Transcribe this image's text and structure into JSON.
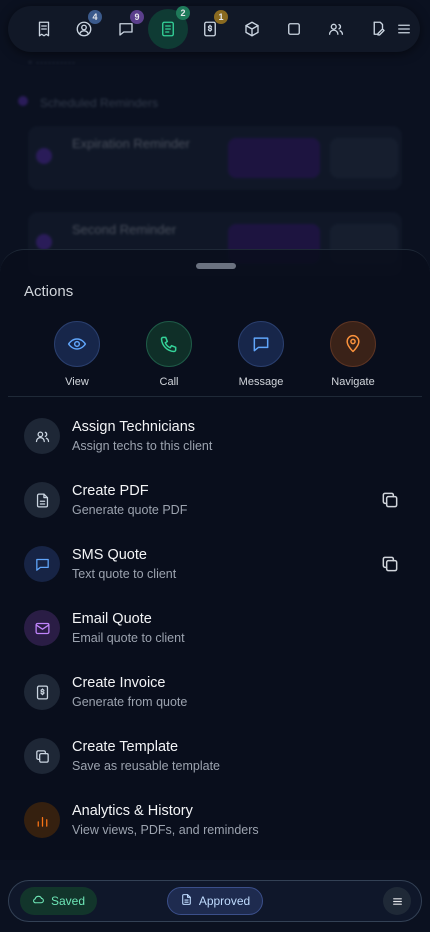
{
  "nav": {
    "items": [
      {
        "icon": "receipt-icon",
        "badge": null
      },
      {
        "icon": "user-circle-icon",
        "badge": "4",
        "badge_color": "#3b5a8c"
      },
      {
        "icon": "chat-icon",
        "badge": "9",
        "badge_color": "#5b3f8c"
      },
      {
        "icon": "document-icon",
        "badge": "2",
        "badge_color": "#1f7a5a",
        "active": true
      },
      {
        "icon": "invoice-icon",
        "badge": "1",
        "badge_color": "#8a6a20"
      },
      {
        "icon": "cube-icon",
        "badge": null
      },
      {
        "icon": "square-icon",
        "badge": null
      },
      {
        "icon": "users-icon",
        "badge": null
      },
      {
        "icon": "pen-icon",
        "badge": null
      },
      {
        "icon": "menu-icon",
        "badge": null
      }
    ]
  },
  "background": {
    "scheduled_reminders": "Scheduled Reminders",
    "expiration_reminder": "Expiration Reminder",
    "second_reminder": "Second Reminder"
  },
  "sheet": {
    "title": "Actions",
    "quick_actions": [
      {
        "label": "View",
        "icon": "eye-icon",
        "color": "#60a5fa",
        "bg": "#17264a",
        "border": "#2a3f6e"
      },
      {
        "label": "Call",
        "icon": "phone-icon",
        "color": "#34d399",
        "bg": "#0f2f28",
        "border": "#1e5a47"
      },
      {
        "label": "Message",
        "icon": "chat-bubble-icon",
        "color": "#60a5fa",
        "bg": "#17264a",
        "border": "#2a3f6e"
      },
      {
        "label": "Navigate",
        "icon": "map-pin-icon",
        "color": "#fb923c",
        "bg": "#3a2218",
        "border": "#5c3423"
      }
    ],
    "actions": [
      {
        "title": "Assign Technicians",
        "subtitle": "Assign techs to this client",
        "icon": "users-icon",
        "bg": "#1e2736",
        "color": "#cbd5e1",
        "copy": false
      },
      {
        "title": "Create PDF",
        "subtitle": "Generate quote PDF",
        "icon": "file-icon",
        "bg": "#1e2736",
        "color": "#cbd5e1",
        "copy": true
      },
      {
        "title": "SMS Quote",
        "subtitle": "Text quote to client",
        "icon": "sms-icon",
        "bg": "#172445",
        "color": "#60a5fa",
        "copy": true
      },
      {
        "title": "Email Quote",
        "subtitle": "Email quote to client",
        "icon": "mail-icon",
        "bg": "#2a1d45",
        "color": "#c084fc",
        "copy": false
      },
      {
        "title": "Create Invoice",
        "subtitle": "Generate from quote",
        "icon": "invoice-icon",
        "bg": "#1e2736",
        "color": "#cbd5e1",
        "copy": false
      },
      {
        "title": "Create Template",
        "subtitle": "Save as reusable template",
        "icon": "copy-icon",
        "bg": "#1e2736",
        "color": "#cbd5e1",
        "copy": false
      },
      {
        "title": "Analytics & History",
        "subtitle": "View views, PDFs, and reminders",
        "icon": "bar-chart-icon",
        "bg": "#35200f",
        "color": "#f97316",
        "copy": false
      }
    ]
  },
  "bottom": {
    "saved_label": "Saved",
    "approved_label": "Approved"
  }
}
